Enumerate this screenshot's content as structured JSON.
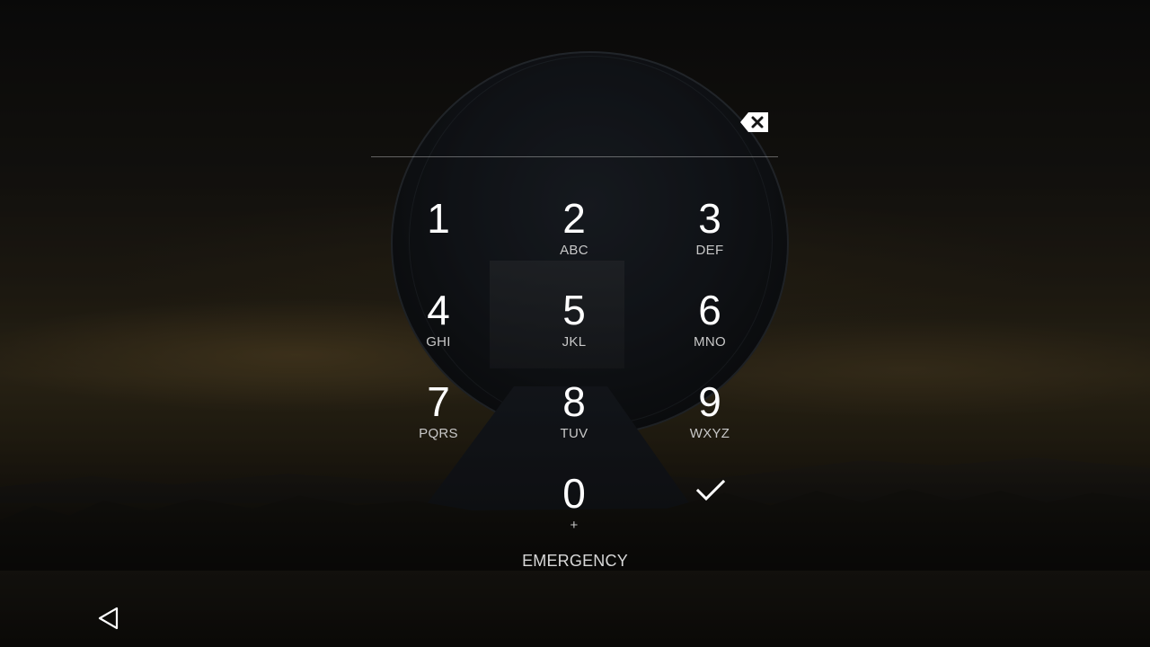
{
  "keypad": {
    "keys": [
      {
        "digit": "1",
        "letters": ""
      },
      {
        "digit": "2",
        "letters": "ABC"
      },
      {
        "digit": "3",
        "letters": "DEF"
      },
      {
        "digit": "4",
        "letters": "GHI"
      },
      {
        "digit": "5",
        "letters": "JKL"
      },
      {
        "digit": "6",
        "letters": "MNO"
      },
      {
        "digit": "7",
        "letters": "PQRS"
      },
      {
        "digit": "8",
        "letters": "TUV"
      },
      {
        "digit": "9",
        "letters": "WXYZ"
      },
      {
        "digit": "0",
        "letters": "+"
      }
    ]
  },
  "pin": {
    "value": ""
  },
  "emergency_label": "EMERGENCY",
  "icons": {
    "backspace": "backspace-icon",
    "confirm": "checkmark-icon",
    "back": "back-triangle-icon"
  },
  "colors": {
    "text": "#ffffff",
    "subtext": "#c8c8c8"
  }
}
